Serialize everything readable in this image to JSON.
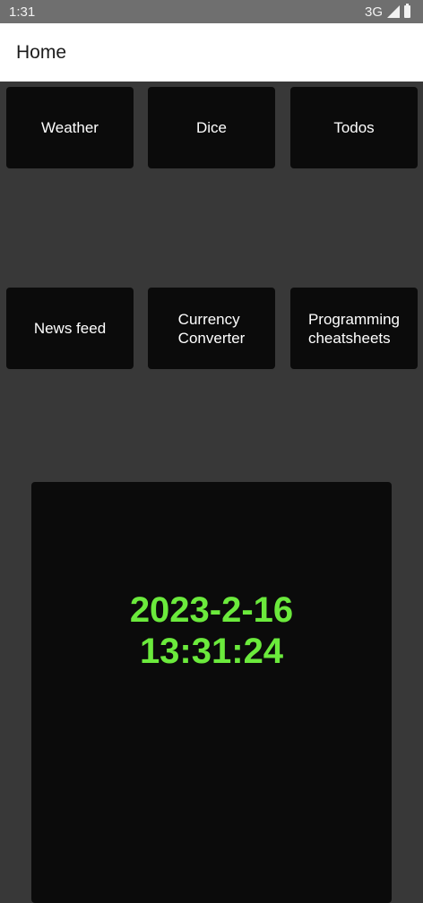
{
  "status_bar": {
    "time": "1:31",
    "network": "3G"
  },
  "app_bar": {
    "title": "Home"
  },
  "tiles": [
    {
      "line1": "Weather",
      "line2": ""
    },
    {
      "line1": "Dice",
      "line2": ""
    },
    {
      "line1": "Todos",
      "line2": ""
    },
    {
      "line1": "News feed",
      "line2": ""
    },
    {
      "line1": "Currency",
      "line2": "Converter"
    },
    {
      "line1": "Programming",
      "line2": "cheatsheets"
    }
  ],
  "clock": {
    "date": "2023-2-16",
    "time": "13:31:24"
  },
  "colors": {
    "background": "#383838",
    "tile": "#0b0b0b",
    "clock_text": "#6bea3c"
  }
}
